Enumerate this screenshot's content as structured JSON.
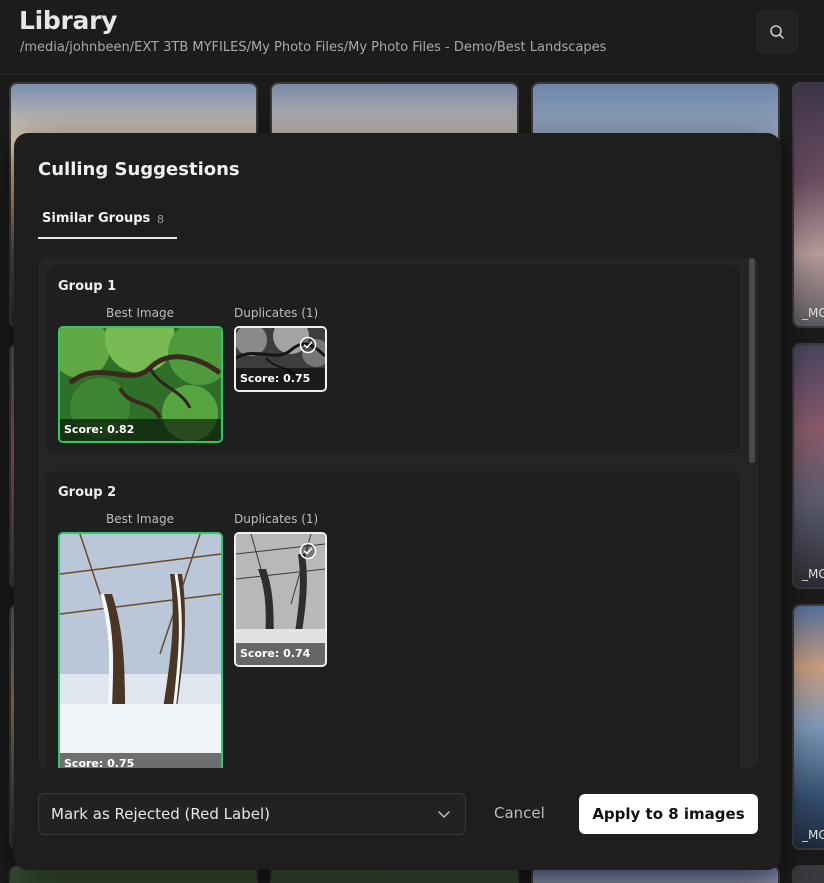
{
  "header": {
    "title": "Library",
    "path": "/media/johnbeen/EXT 3TB MYFILES/My Photo Files/My Photo Files - Demo/Best Landscapes",
    "search_icon": "search-icon"
  },
  "grid": {
    "tile_names": [
      "_MG",
      "_MG",
      "_MG"
    ]
  },
  "modal": {
    "title": "Culling Suggestions",
    "tab": {
      "label": "Similar Groups",
      "count": "8"
    },
    "groups": [
      {
        "title": "Group 1",
        "best_label": "Best Image",
        "dup_label": "Duplicates (1)",
        "best_score": "Score: 0.82",
        "dup_score": "Score: 0.75"
      },
      {
        "title": "Group 2",
        "best_label": "Best Image",
        "dup_label": "Duplicates (1)",
        "best_score": "Score: 0.75",
        "dup_score": "Score: 0.74"
      }
    ],
    "footer": {
      "action_select": "Mark as Rejected (Red Label)",
      "cancel": "Cancel",
      "apply": "Apply to 8 images"
    }
  },
  "colors": {
    "best_border": "#34c66a",
    "dup_border": "#f0f0f0",
    "background": "#1b1b1b",
    "modal": "#1e1e1e"
  }
}
